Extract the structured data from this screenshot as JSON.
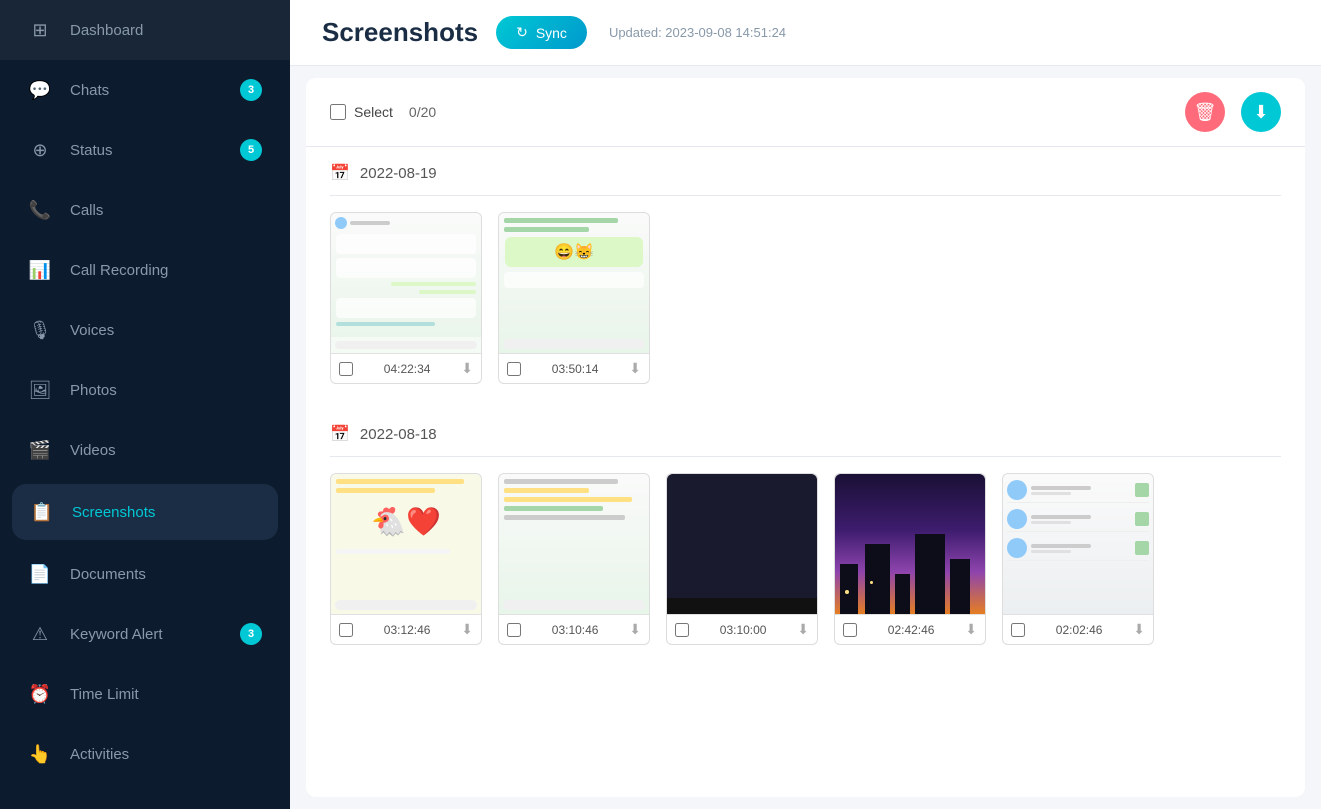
{
  "sidebar": {
    "items": [
      {
        "id": "dashboard",
        "label": "Dashboard",
        "icon": "⊞",
        "badge": null,
        "active": false
      },
      {
        "id": "chats",
        "label": "Chats",
        "icon": "💬",
        "badge": "3",
        "active": false
      },
      {
        "id": "status",
        "label": "Status",
        "icon": "⊕",
        "badge": "5",
        "active": false
      },
      {
        "id": "calls",
        "label": "Calls",
        "icon": "📞",
        "badge": null,
        "active": false
      },
      {
        "id": "call-recording",
        "label": "Call Recording",
        "icon": "📊",
        "badge": null,
        "active": false
      },
      {
        "id": "voices",
        "label": "Voices",
        "icon": "🎙",
        "badge": null,
        "active": false
      },
      {
        "id": "photos",
        "label": "Photos",
        "icon": "🖼",
        "badge": null,
        "active": false
      },
      {
        "id": "videos",
        "label": "Videos",
        "icon": "🎬",
        "badge": null,
        "active": false
      },
      {
        "id": "screenshots",
        "label": "Screenshots",
        "icon": "📋",
        "badge": null,
        "active": true
      },
      {
        "id": "documents",
        "label": "Documents",
        "icon": "📄",
        "badge": null,
        "active": false
      },
      {
        "id": "keyword-alert",
        "label": "Keyword Alert",
        "icon": "⚠",
        "badge": "3",
        "active": false
      },
      {
        "id": "time-limit",
        "label": "Time Limit",
        "icon": "⏰",
        "badge": null,
        "active": false
      },
      {
        "id": "activities",
        "label": "Activities",
        "icon": "👆",
        "badge": null,
        "active": false
      }
    ]
  },
  "header": {
    "title": "Screenshots",
    "sync_label": "Sync",
    "updated_text": "Updated: 2023-09-08 14:51:24"
  },
  "toolbar": {
    "select_label": "Select",
    "select_count": "0/20",
    "delete_icon": "🗑",
    "download_icon": "⬇"
  },
  "sections": [
    {
      "date": "2022-08-19",
      "screenshots": [
        {
          "time": "04:22:34",
          "type": "chat1"
        },
        {
          "time": "03:50:14",
          "type": "chat2"
        }
      ]
    },
    {
      "date": "2022-08-18",
      "screenshots": [
        {
          "time": "03:12:46",
          "type": "chat3"
        },
        {
          "time": "03:10:46",
          "type": "chat4"
        },
        {
          "time": "03:10:00",
          "type": "dark"
        },
        {
          "time": "02:42:46",
          "type": "city"
        },
        {
          "time": "02:02:46",
          "type": "contacts"
        }
      ]
    }
  ],
  "colors": {
    "sidebar_bg": "#0d1b2e",
    "active_bg": "#1a2d44",
    "accent": "#00c8d4",
    "delete": "#ff6b7a"
  }
}
